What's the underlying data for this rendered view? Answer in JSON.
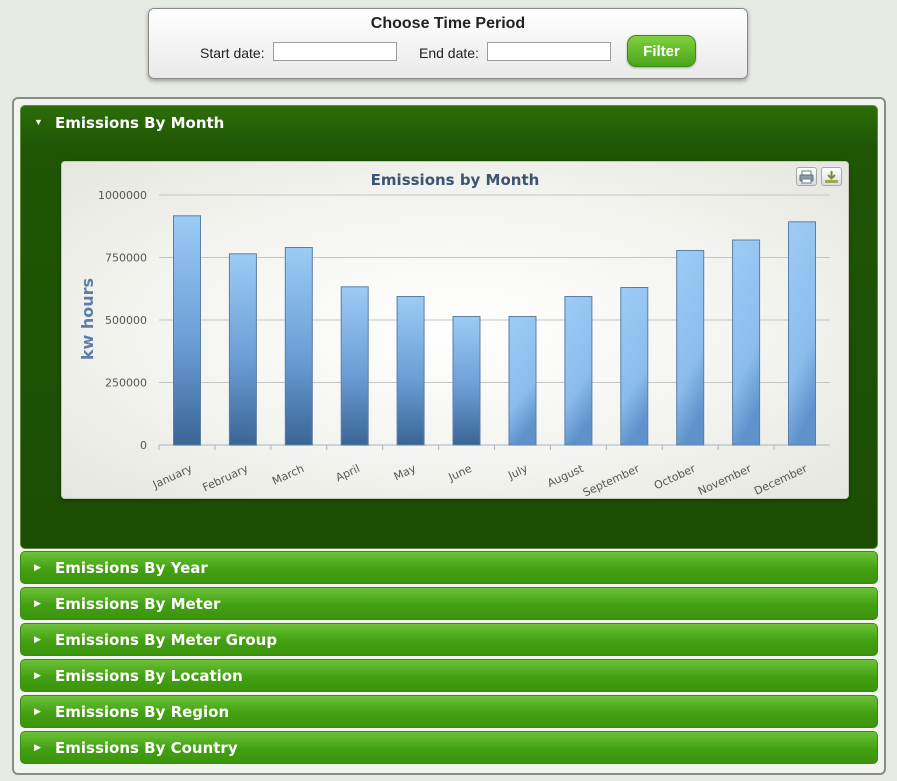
{
  "filter": {
    "title": "Choose Time Period",
    "start_label": "Start date:",
    "start_value": "",
    "end_label": "End date:",
    "end_value": "",
    "button_label": "Filter"
  },
  "accordion": {
    "active": {
      "label": "Emissions By Month",
      "expanded": true
    },
    "items": [
      {
        "label": "Emissions By Year"
      },
      {
        "label": "Emissions By Meter"
      },
      {
        "label": "Emissions By Meter Group"
      },
      {
        "label": "Emissions By Location"
      },
      {
        "label": "Emissions By Region"
      },
      {
        "label": "Emissions By Country"
      }
    ]
  },
  "colors": {
    "active_header": "#1f5605",
    "item_header": "#4ca51b",
    "bar_top": "#99c9f5",
    "bar_bottom": "#3a6596",
    "title": "#3b5573"
  },
  "chart_data": {
    "type": "bar",
    "title": "Emissions by Month",
    "xlabel": "",
    "ylabel": "kw hours",
    "categories": [
      "January",
      "February",
      "March",
      "April",
      "May",
      "June",
      "July",
      "August",
      "September",
      "October",
      "November",
      "December"
    ],
    "values": [
      917000,
      765000,
      790000,
      633000,
      594000,
      514000,
      514000,
      594000,
      630000,
      778000,
      820000,
      893000
    ],
    "ylim": [
      0,
      1000000
    ],
    "yticks": [
      "1000000",
      "750000",
      "500000",
      "250000",
      "0"
    ],
    "grid": true,
    "legend": "none",
    "tools": [
      "print-icon",
      "download-icon"
    ]
  }
}
